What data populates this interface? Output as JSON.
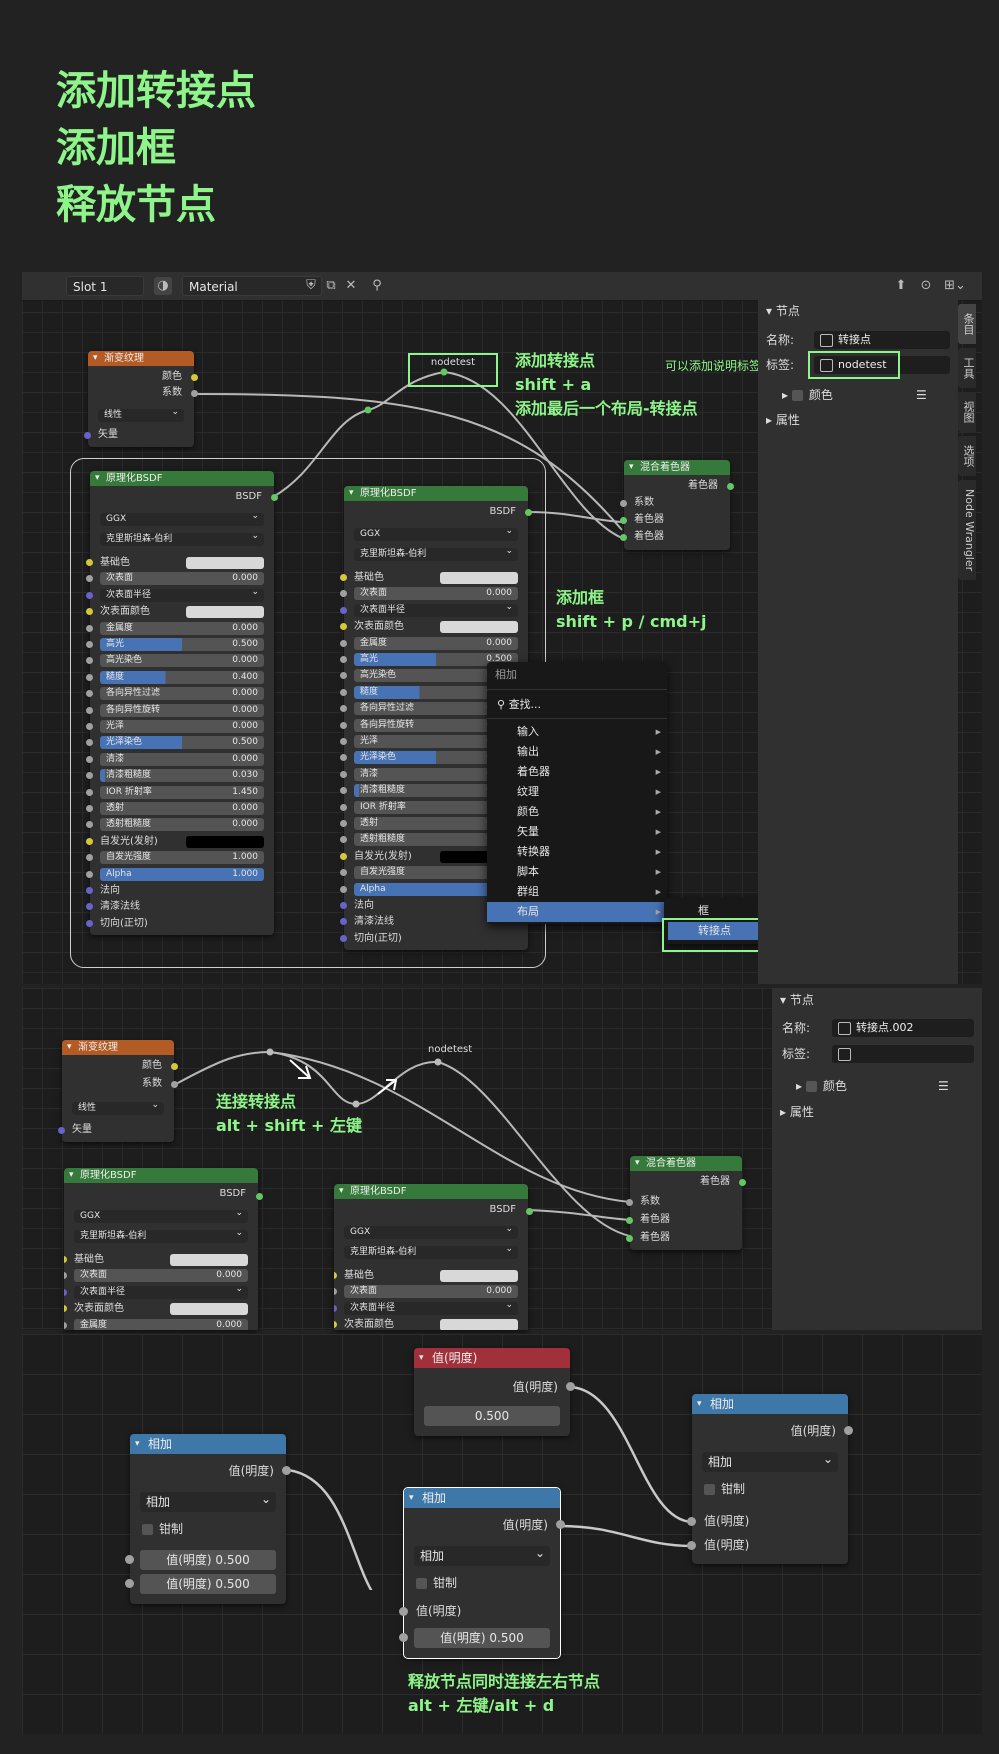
{
  "titles": [
    "添加转接点",
    "添加框",
    "释放节点"
  ],
  "toolbar": {
    "slot": "Slot 1",
    "material": "Material"
  },
  "annotations": {
    "reroute_title": "添加转接点",
    "reroute_key": "shift + a",
    "reroute_desc": "添加最后一个布局-转接点",
    "label_hint": "可以添加说明标签",
    "frame_title": "添加框",
    "frame_key": "shift + p / cmd+j",
    "connect_title": "连接转接点",
    "connect_key": "alt + shift + 左键",
    "release_title": "释放节点同时连接左右节点",
    "release_key": "alt + 左键/alt + d"
  },
  "reroute_label": "nodetest",
  "gradient_node": {
    "title": "渐变纹理",
    "out1": "颜色",
    "out2": "系数",
    "mode": "线性",
    "in1": "矢量"
  },
  "bsdf": {
    "title": "原理化BSDF",
    "out": "BSDF",
    "dist": "GGX",
    "sss": "克里斯坦森-伯利",
    "rows": [
      {
        "label": "基础色",
        "type": "color",
        "sock": "y"
      },
      {
        "label": "次表面",
        "value": "0.000",
        "type": "num",
        "sock": "gr"
      },
      {
        "label": "次表面半径",
        "type": "dd",
        "sock": "p"
      },
      {
        "label": "次表面颜色",
        "type": "color",
        "sock": "y"
      },
      {
        "label": "金属度",
        "value": "0.000",
        "type": "num",
        "sock": "gr"
      },
      {
        "label": "高光",
        "value": "0.500",
        "type": "bar",
        "fill": 0.5,
        "sock": "gr"
      },
      {
        "label": "高光染色",
        "value": "0.000",
        "type": "num",
        "sock": "gr"
      },
      {
        "label": "糙度",
        "value": "0.400",
        "type": "bar",
        "fill": 0.4,
        "sock": "gr"
      },
      {
        "label": "各向异性过滤",
        "value": "0.000",
        "type": "num",
        "sock": "gr"
      },
      {
        "label": "各向异性旋转",
        "value": "0.000",
        "type": "num",
        "sock": "gr"
      },
      {
        "label": "光泽",
        "value": "0.000",
        "type": "num",
        "sock": "gr"
      },
      {
        "label": "光泽染色",
        "value": "0.500",
        "type": "bar",
        "fill": 0.5,
        "sock": "gr"
      },
      {
        "label": "清漆",
        "value": "0.000",
        "type": "num",
        "sock": "gr"
      },
      {
        "label": "清漆粗糙度",
        "value": "0.030",
        "type": "bar",
        "fill": 0.03,
        "sock": "gr"
      },
      {
        "label": "IOR 折射率",
        "value": "1.450",
        "type": "num",
        "sock": "gr"
      },
      {
        "label": "透射",
        "value": "0.000",
        "type": "num",
        "sock": "gr"
      },
      {
        "label": "透射粗糙度",
        "value": "0.000",
        "type": "num",
        "sock": "gr"
      },
      {
        "label": "自发光(发射)",
        "type": "black",
        "sock": "y"
      },
      {
        "label": "自发光强度",
        "value": "1.000",
        "type": "num",
        "sock": "gr"
      },
      {
        "label": "Alpha",
        "value": "1.000",
        "type": "bar",
        "fill": 1,
        "sock": "gr"
      },
      {
        "label": "法向",
        "type": "text",
        "sock": "p"
      },
      {
        "label": "清漆法线",
        "type": "text",
        "sock": "p"
      },
      {
        "label": "切向(正切)",
        "type": "text",
        "sock": "p"
      }
    ]
  },
  "mix_node": {
    "title": "混合着色器",
    "out": "着色器",
    "in1": "系数",
    "in2": "着色器",
    "in3": "着色器"
  },
  "sidebar1": {
    "section": "节点",
    "name_label": "名称:",
    "name_value": "转接点",
    "label_label": "标签:",
    "label_value": "nodetest",
    "color": "颜色",
    "props": "属性"
  },
  "sidebar2": {
    "section": "节点",
    "name_label": "名称:",
    "name_value": "转接点.002",
    "label_label": "标签:",
    "label_value": "",
    "color": "颜色",
    "props": "属性"
  },
  "tabs": [
    "条目",
    "工具",
    "视图",
    "选项",
    "Node Wrangler"
  ],
  "add_menu": {
    "title": "相加",
    "search": "查找...",
    "items": [
      "输入",
      "输出",
      "着色器",
      "纹理",
      "颜色",
      "矢量",
      "转换器",
      "脚本",
      "群组",
      "布局"
    ],
    "sub": [
      "框",
      "转接点"
    ]
  },
  "math_nodes": {
    "value_title": "值(明度)",
    "value_out": "值(明度)",
    "value_val": "0.500",
    "add_title": "相加",
    "add_out": "值(明度)",
    "add_op": "相加",
    "clamp": "钳制",
    "in_label": "值(明度)",
    "in_val": "0.500"
  }
}
